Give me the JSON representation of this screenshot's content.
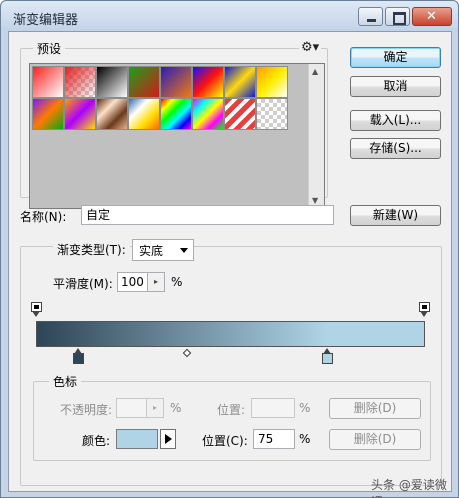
{
  "window": {
    "title": "渐变编辑器",
    "controls": [
      "minimize-icon",
      "maximize-icon",
      "close-icon"
    ]
  },
  "presets": {
    "legend": "预设",
    "gear_icon": "⚙▾",
    "swatches": [
      "linear-gradient(135deg,#ff2020,#ffffff)",
      "linear-gradient(135deg,#e32222,rgba(255,255,255,0))",
      "linear-gradient(135deg,#000000,#ffffff)",
      "linear-gradient(135deg,#1aa11a,#d31a1a)",
      "linear-gradient(135deg,#2a1bb8,#ef7a14)",
      "linear-gradient(135deg,#1010ff,#ff1010,#ffff00)",
      "linear-gradient(135deg,#0a1bd8,#ffd90f,#0a1bd8)",
      "linear-gradient(135deg,#ff9b00,#ffee00,#ffffff)",
      "linear-gradient(135deg,#7a1aff,#ff7a00,#08a814)",
      "linear-gradient(135deg,#ff9d00,#aa00ff,#ffde00)",
      "linear-gradient(135deg,#5a2b0d,#ffe0c6,#6b3a1e,#e5b48d)",
      "linear-gradient(135deg,#2b6bb0,#ffffff,#ffdd00,#ff6a00)",
      "linear-gradient(135deg,#ff0000,#ffff00,#00ff00,#00ffff,#0000ff,#ff00ff)",
      "linear-gradient(135deg,#ff00ff,#00ffff,#ffff00,#ff00ff,#00ff00)",
      "repeating-linear-gradient(135deg,#e44040 0 5px,#ffffff 5px 9px)",
      "linear-gradient(135deg,rgba(255,255,255,0),rgba(255,255,255,0))"
    ]
  },
  "buttons": {
    "ok": "确定",
    "cancel": "取消",
    "load": "载入(L)...",
    "save": "存储(S)...",
    "new": "新建(W)"
  },
  "name": {
    "label": "名称(N):",
    "value": "自定"
  },
  "gradient_type": {
    "label": "渐变类型(T):",
    "value": "实底"
  },
  "smoothness": {
    "label": "平滑度(M):",
    "value": "100",
    "unit": "%"
  },
  "gradient": {
    "colors": [
      "#2d4556",
      "#aed4e6"
    ],
    "midpoint_percent": 52,
    "color_stop_location_percent": 75
  },
  "stops": {
    "legend": "色标",
    "opacity_label": "不透明度:",
    "opacity_unit": "%",
    "location_label_top": "位置:",
    "location_unit_top": "%",
    "delete_label": "删除(D)",
    "color_label": "颜色:",
    "color_value": "#aed4e6",
    "location_label": "位置(C):",
    "location_value": "75",
    "location_unit": "%"
  },
  "watermark": "头条 @爱读微课"
}
